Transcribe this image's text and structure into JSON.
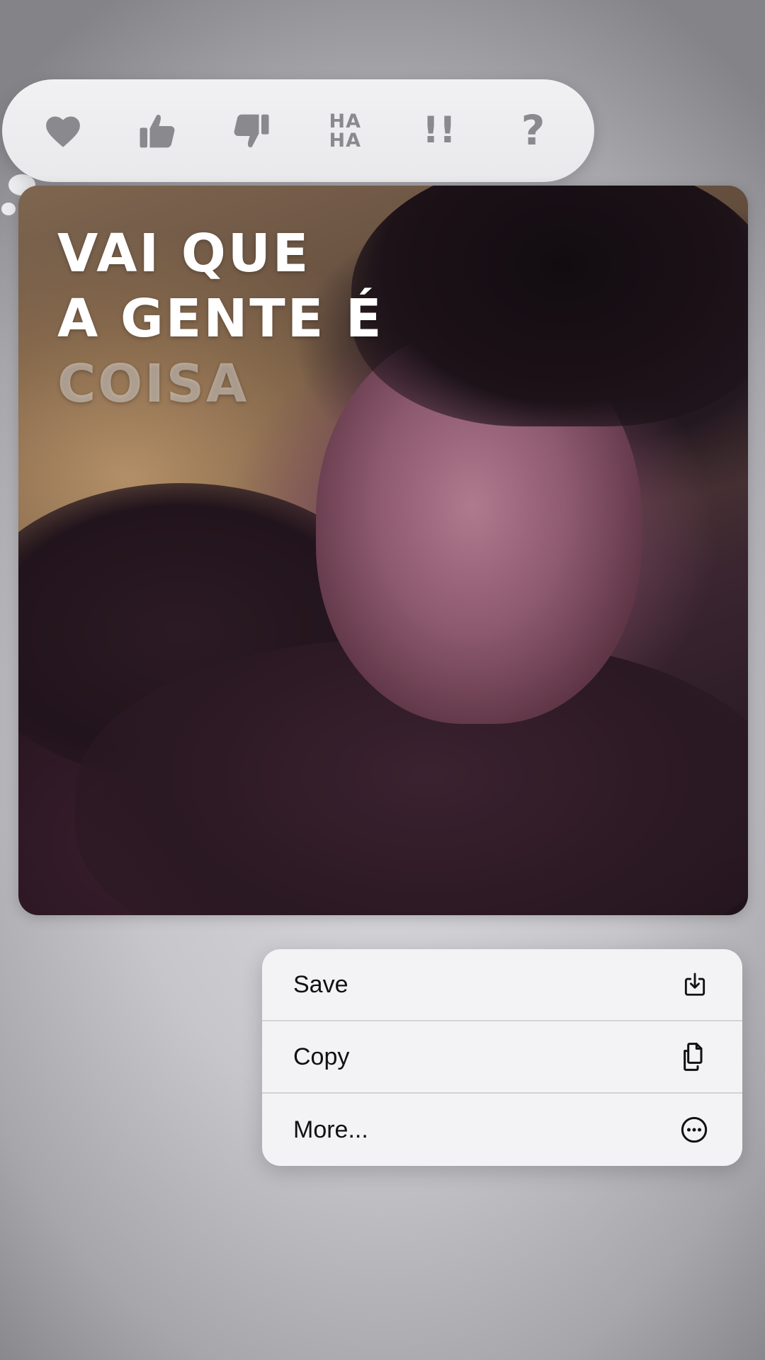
{
  "reactions": {
    "items": [
      {
        "name": "heart",
        "icon": "heart-icon"
      },
      {
        "name": "thumbs-up",
        "icon": "thumbs-up-icon"
      },
      {
        "name": "thumbs-down",
        "icon": "thumbs-down-icon"
      },
      {
        "name": "haha",
        "icon": "haha-icon",
        "line1": "HA",
        "line2": "HA"
      },
      {
        "name": "emphasize",
        "icon": "double-exclamation-icon",
        "text": "!!"
      },
      {
        "name": "question",
        "icon": "question-mark-icon",
        "text": "?"
      }
    ],
    "icon_color": "#8a8a8e",
    "background": "#ececef"
  },
  "message": {
    "overlay_lines": [
      "VAI QUE",
      "A GENTE É",
      "COISA"
    ]
  },
  "context_menu": {
    "items": [
      {
        "label": "Save",
        "icon": "save-download-icon"
      },
      {
        "label": "Copy",
        "icon": "copy-documents-icon"
      },
      {
        "label": "More...",
        "icon": "more-ellipsis-circle-icon"
      }
    ]
  }
}
